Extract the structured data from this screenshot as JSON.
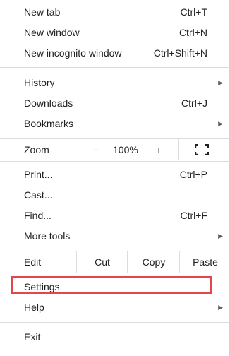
{
  "menu": {
    "new_tab": {
      "label": "New tab",
      "shortcut": "Ctrl+T"
    },
    "new_window": {
      "label": "New window",
      "shortcut": "Ctrl+N"
    },
    "new_incognito": {
      "label": "New incognito window",
      "shortcut": "Ctrl+Shift+N"
    },
    "history": {
      "label": "History"
    },
    "downloads": {
      "label": "Downloads",
      "shortcut": "Ctrl+J"
    },
    "bookmarks": {
      "label": "Bookmarks"
    },
    "zoom": {
      "label": "Zoom",
      "minus": "−",
      "level": "100%",
      "plus": "+"
    },
    "print": {
      "label": "Print...",
      "shortcut": "Ctrl+P"
    },
    "cast": {
      "label": "Cast..."
    },
    "find": {
      "label": "Find...",
      "shortcut": "Ctrl+F"
    },
    "more_tools": {
      "label": "More tools"
    },
    "edit": {
      "label": "Edit",
      "cut": "Cut",
      "copy": "Copy",
      "paste": "Paste"
    },
    "settings": {
      "label": "Settings"
    },
    "help": {
      "label": "Help"
    },
    "exit": {
      "label": "Exit"
    }
  },
  "highlight_color": "#e2474b",
  "submenu_arrow": "▶",
  "icons": {
    "fullscreen": "fullscreen-icon",
    "submenu": "submenu-arrow-icon"
  }
}
